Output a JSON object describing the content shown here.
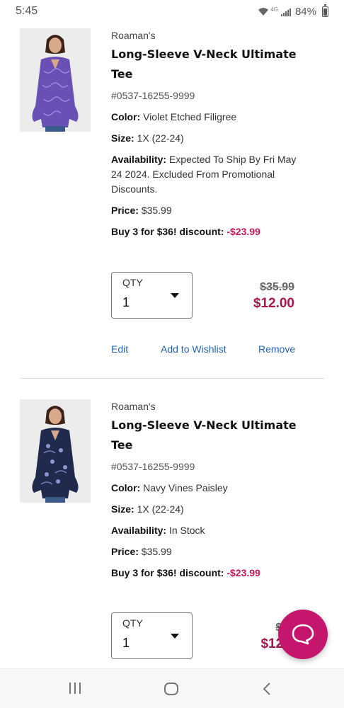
{
  "status_bar": {
    "time": "5:45",
    "network": "4G",
    "battery": "84%"
  },
  "colors": {
    "accent": "#c4166d",
    "price_red": "#a3174a",
    "discount_red": "#c2185b",
    "link_blue": "#2563a8"
  },
  "items": [
    {
      "brand": "Roaman's",
      "name_line1": "Long-Sleeve V-Neck Ultimate",
      "name_line2": "Tee",
      "sku": "#0537-16255-9999",
      "color_label": "Color:",
      "color_value": " Violet Etched Filigree",
      "size_label": "Size:",
      "size_value": " 1X (22-24)",
      "availability_label": "Availability:",
      "availability_line1": " Expected To Ship By Fri May",
      "availability_line2": "24 2024. Excluded From Promotional",
      "availability_line3": "Discounts.",
      "price_label": "Price:",
      "price_value": " $35.99",
      "discount_label": "Buy 3 for $36! discount: ",
      "discount_value": "-$23.99",
      "qty_label": "QTY",
      "qty_value": "1",
      "old_price": "$35.99",
      "new_price": "$12.00",
      "edit": "Edit",
      "wishlist": "Add to Wishlist",
      "remove": "Remove"
    },
    {
      "brand": "Roaman's",
      "name_line1": "Long-Sleeve V-Neck Ultimate",
      "name_line2": "Tee",
      "sku": "#0537-16255-9999",
      "color_label": "Color:",
      "color_value": " Navy Vines Paisley",
      "size_label": "Size:",
      "size_value": " 1X (22-24)",
      "availability_label": "Availability:",
      "availability_value": " In Stock",
      "price_label": "Price:",
      "price_value": " $35.99",
      "discount_label": "Buy 3 for $36! discount: ",
      "discount_value": "-$23.99",
      "qty_label": "QTY",
      "qty_value": "1",
      "old_price": "$35",
      "new_price": "$12.0"
    }
  ],
  "icons": {
    "chat": "chat-bubble-icon",
    "nav_recents": "recent-apps-icon",
    "nav_home": "home-icon",
    "nav_back": "back-icon"
  }
}
